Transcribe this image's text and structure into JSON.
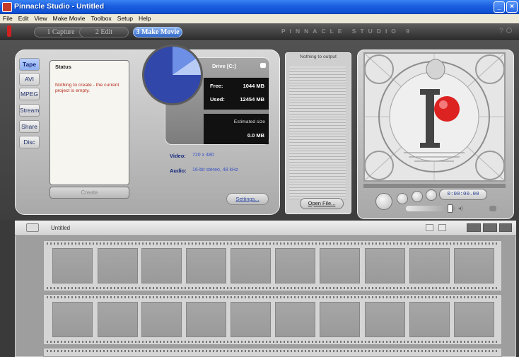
{
  "window": {
    "title": "Pinnacle Studio - Untitled"
  },
  "menu": [
    "File",
    "Edit",
    "View",
    "Make Movie",
    "Toolbox",
    "Setup",
    "Help"
  ],
  "tabs": {
    "capture": "1 Capture",
    "edit": "2 Edit",
    "make_movie": "3 Make Movie"
  },
  "brand": "PINNACLE STUDIO 9",
  "side_tabs": [
    "Tape",
    "AVI",
    "MPEG",
    "Stream",
    "Share",
    "Disc"
  ],
  "status": {
    "label": "Status",
    "message": "Nothing to create - the current project is empty."
  },
  "create_label": "Create",
  "drive": {
    "label": "Drive [C:]",
    "free_key": "Free:",
    "free_value": "1044 MB",
    "used_key": "Used:",
    "used_value": "12454 MB",
    "est_label": "Estimated size",
    "est_value": "0.0 MB"
  },
  "media": {
    "video_key": "Video:",
    "video_value": "720 x 480",
    "audio_key": "Audio:",
    "audio_value": "16-bit stereo, 48 kHz"
  },
  "settings_label": "Settings...",
  "output": {
    "header": "Nothing to output",
    "open_label": "Open File..."
  },
  "player": {
    "timecode": "0:00:00.00"
  },
  "album": {
    "title": "Untitled"
  },
  "colors": {
    "titlebar": "#1a5fe0",
    "status_text": "#b52b1b",
    "active_tab": "#2e66c8"
  }
}
